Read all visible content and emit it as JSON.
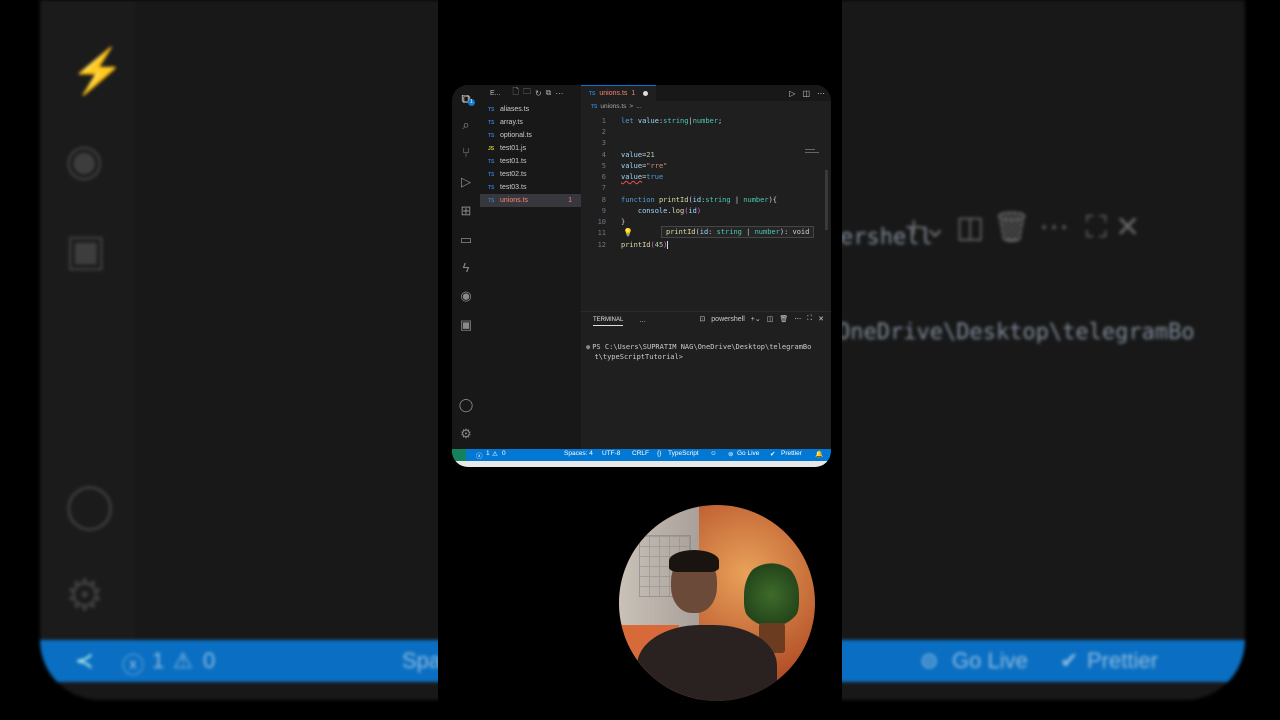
{
  "explorer": {
    "title": "E...",
    "files": [
      {
        "type": "TS",
        "name": "aliases.ts"
      },
      {
        "type": "TS",
        "name": "array.ts"
      },
      {
        "type": "TS",
        "name": "optional.ts"
      },
      {
        "type": "JS",
        "name": "test01.js"
      },
      {
        "type": "TS",
        "name": "test01.ts"
      },
      {
        "type": "TS",
        "name": "test02.ts"
      },
      {
        "type": "TS",
        "name": "test03.ts"
      },
      {
        "type": "TS",
        "name": "unions.ts",
        "count": "1"
      }
    ]
  },
  "activity": {
    "badge": "1"
  },
  "tab": {
    "type": "TS",
    "name": "unions.ts",
    "problems": "1"
  },
  "breadcrumb": {
    "type": "TS",
    "file": "unions.ts",
    "sep": ">",
    "rest": "..."
  },
  "code": {
    "n1": "1",
    "n2": "2",
    "n3": "3",
    "n4": "4",
    "n5": "5",
    "n6": "6",
    "n7": "7",
    "n8": "8",
    "n9": "9",
    "n10": "10",
    "n11": "11",
    "n12": "12",
    "l1_kw": "let",
    "l1_var": "value",
    "l1_c": ":",
    "l1_t1": "string",
    "l1_p": "|",
    "l1_t2": "number",
    "l1_s": ";",
    "l4_v": "value",
    "l4_eq": "=",
    "l4_n": "21",
    "l5_v": "value",
    "l5_eq": "=",
    "l5_s": "\"rre\"",
    "l6_v": "value",
    "l6_eq": "=",
    "l6_b": "true",
    "l8_kw": "function",
    "l8_fn": "printId",
    "l8_o": "(",
    "l8_a": "id",
    "l8_c": ":",
    "l8_t1": "string",
    "l8_p": " | ",
    "l8_t2": "number",
    "l8_cl": "){",
    "l9_obj": "console",
    "l9_d": ".",
    "l9_fn": "log",
    "l9_o": "(",
    "l9_a": "id",
    "l9_c": ")",
    "l10": "}",
    "l12_fn": "printId",
    "l12_o": "(",
    "l12_n": "45",
    "l12_c": ")"
  },
  "hint": {
    "fn": "printId",
    "o": "(",
    "p": "id",
    "c": ": ",
    "t1": "string",
    "pipe": " | ",
    "t2": "number",
    "ret": "): void"
  },
  "panel": {
    "tab": "TERMINAL",
    "more": "...",
    "shell": "powershell"
  },
  "terminal": {
    "line1": "PS C:\\Users\\SUPRATIM NAG\\OneDrive\\Desktop\\telegramBo",
    "line2": "t\\typeScriptTutorial>"
  },
  "status": {
    "errors": "1",
    "warnings": "0",
    "spaces": "Spaces: 4",
    "encoding": "UTF-8",
    "eol": "CRLF",
    "language": "TypeScript",
    "golive": "Go Live",
    "prettier": "Prettier"
  },
  "backdrop": {
    "shell": "ershell",
    "path": "OneDrive\\Desktop\\telegramBo",
    "errors": "1",
    "warnings": "0",
    "spaces": "Spa",
    "golive": "Go Live",
    "prettier": "Prettier"
  }
}
